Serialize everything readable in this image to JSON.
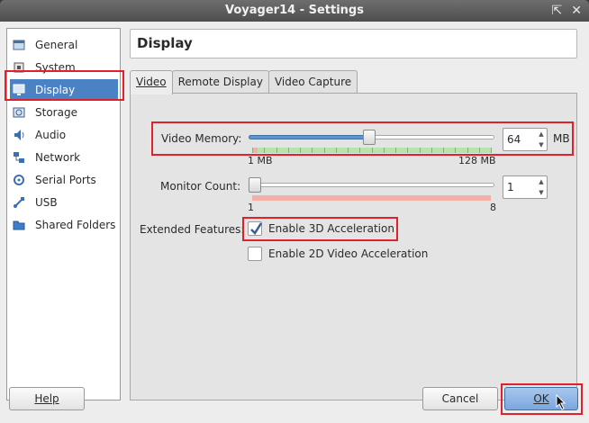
{
  "window": {
    "title": "Voyager14 - Settings",
    "colors": {
      "selection": "#4a82c4",
      "highlight": "#e0202a"
    }
  },
  "sidebar": {
    "items": [
      {
        "label": "General",
        "icon": "general-icon"
      },
      {
        "label": "System",
        "icon": "system-icon"
      },
      {
        "label": "Display",
        "icon": "display-icon",
        "selected": true
      },
      {
        "label": "Storage",
        "icon": "storage-icon"
      },
      {
        "label": "Audio",
        "icon": "audio-icon"
      },
      {
        "label": "Network",
        "icon": "network-icon"
      },
      {
        "label": "Serial Ports",
        "icon": "serial-ports-icon"
      },
      {
        "label": "USB",
        "icon": "usb-icon"
      },
      {
        "label": "Shared Folders",
        "icon": "shared-folders-icon"
      }
    ]
  },
  "page": {
    "title": "Display"
  },
  "tabs": [
    {
      "label": "Video",
      "active": true
    },
    {
      "label": "Remote Display"
    },
    {
      "label": "Video Capture"
    }
  ],
  "video": {
    "memory": {
      "label": "Video Memory:",
      "value": "64",
      "unit": "MB",
      "min_label": "1 MB",
      "max_label": "128 MB",
      "fraction": 0.49
    },
    "monitors": {
      "label": "Monitor Count:",
      "value": "1",
      "min_label": "1",
      "max_label": "8",
      "fraction": 0.0
    },
    "extended": {
      "label": "Extended Features:",
      "accel3d": {
        "label": "Enable 3D Acceleration",
        "checked": true
      },
      "accel2d": {
        "label": "Enable 2D Video Acceleration",
        "checked": false
      }
    }
  },
  "buttons": {
    "help": "Help",
    "cancel": "Cancel",
    "ok": "OK"
  }
}
